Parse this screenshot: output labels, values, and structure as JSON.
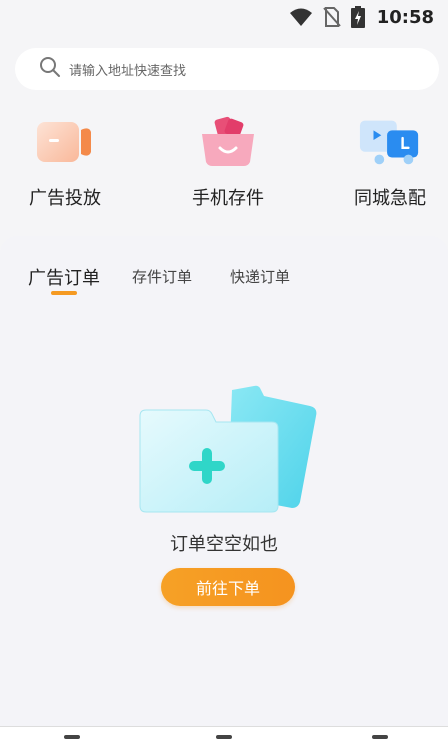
{
  "status_bar": {
    "time": "10:58",
    "icons": [
      "wifi-icon",
      "no-sim-icon",
      "battery-charging-icon"
    ]
  },
  "search": {
    "placeholder": "请输入地址快速查找",
    "icon": "search-icon"
  },
  "quick_actions": [
    {
      "label": "广告投放",
      "icon": "video-camera-icon"
    },
    {
      "label": "手机存件",
      "icon": "phone-storage-icon"
    },
    {
      "label": "同城急配",
      "icon": "delivery-truck-icon"
    }
  ],
  "tabs": [
    {
      "label": "广告订单",
      "active": true
    },
    {
      "label": "存件订单",
      "active": false
    },
    {
      "label": "快递订单",
      "active": false
    }
  ],
  "colors": {
    "accent": "#f5931f"
  },
  "empty_state": {
    "message": "订单空空如也",
    "button_label": "前往下单",
    "illustration": "empty-folder-icon"
  },
  "bottom_nav": {
    "items": [
      "nav-item-1",
      "nav-item-2",
      "nav-item-3"
    ]
  }
}
